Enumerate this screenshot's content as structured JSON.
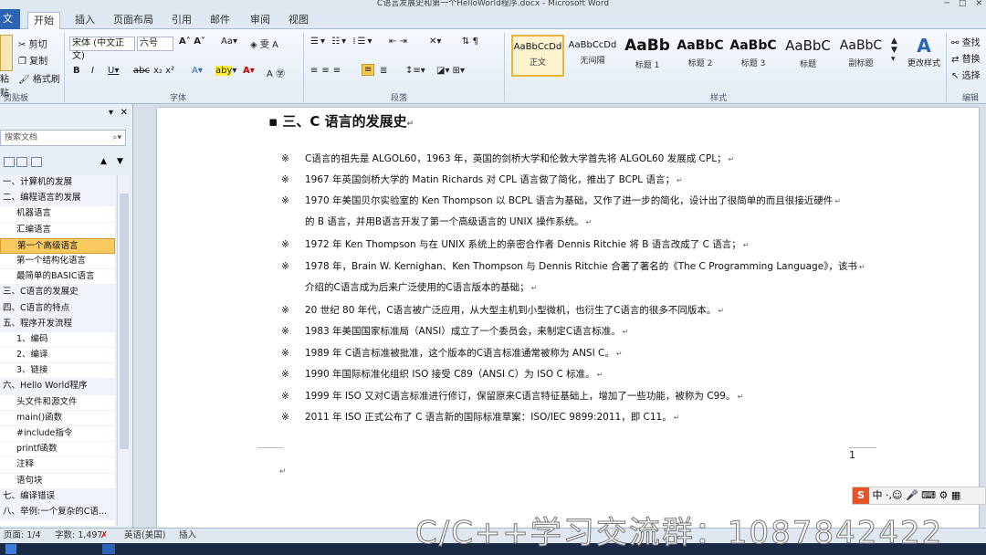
{
  "window": {
    "title": "C语言发展史和第一个HelloWorld程序.docx - Microsoft Word"
  },
  "tabs": [
    "文件",
    "开始",
    "插入",
    "页面布局",
    "引用",
    "邮件",
    "审阅",
    "视图"
  ],
  "ribbon": {
    "clipboard": {
      "paste": "粘贴",
      "cut": "剪切",
      "copy": "复制",
      "format_painter": "格式刷",
      "label": "剪贴板"
    },
    "font": {
      "font_name": "宋体 (中文正文)",
      "font_size": "六号",
      "label": "字体"
    },
    "paragraph": {
      "label": "段落"
    },
    "styles": {
      "label": "样式",
      "items": [
        {
          "sample": "AaBbCcDd",
          "name": "正文"
        },
        {
          "sample": "AaBbCcDd",
          "name": "无间隔"
        },
        {
          "sample": "AaBb",
          "name": "标题 1"
        },
        {
          "sample": "AaBbC",
          "name": "标题 2"
        },
        {
          "sample": "AaBbC",
          "name": "标题 3"
        },
        {
          "sample": "AaBbC",
          "name": "标题"
        },
        {
          "sample": "AaBbC",
          "name": "副标题"
        }
      ],
      "change_styles": "更改样式"
    },
    "editing": {
      "find": "查找",
      "replace": "替换",
      "select": "选择",
      "label": "编辑"
    }
  },
  "navpane": {
    "search_placeholder": "搜索文档",
    "items": [
      {
        "text": "一、计算机的发展",
        "level": 1,
        "selected": false
      },
      {
        "text": "二、编程语言的发展",
        "level": 1,
        "selected": false
      },
      {
        "text": "机器语言",
        "level": 2,
        "selected": false
      },
      {
        "text": "汇编语言",
        "level": 2,
        "selected": false
      },
      {
        "text": "第一个高级语言",
        "level": 2,
        "selected": true
      },
      {
        "text": "第一个结构化语言",
        "level": 2,
        "selected": false
      },
      {
        "text": "最简单的BASIC语言",
        "level": 2,
        "selected": false
      },
      {
        "text": "三、C语言的发展史",
        "level": 1,
        "selected": false
      },
      {
        "text": "四、C语言的特点",
        "level": 1,
        "selected": false
      },
      {
        "text": "五、程序开发流程",
        "level": 1,
        "selected": false
      },
      {
        "text": "1、编码",
        "level": 2,
        "selected": false
      },
      {
        "text": "2、编译",
        "level": 2,
        "selected": false
      },
      {
        "text": "3、链接",
        "level": 2,
        "selected": false
      },
      {
        "text": "六、Hello World程序",
        "level": 1,
        "selected": false
      },
      {
        "text": "头文件和源文件",
        "level": 2,
        "selected": false
      },
      {
        "text": "main()函数",
        "level": 2,
        "selected": false
      },
      {
        "text": "#include指令",
        "level": 2,
        "selected": false
      },
      {
        "text": "printf函数",
        "level": 2,
        "selected": false
      },
      {
        "text": "注释",
        "level": 2,
        "selected": false
      },
      {
        "text": "语句块",
        "level": 2,
        "selected": false
      },
      {
        "text": "七、编译错误",
        "level": 1,
        "selected": false
      },
      {
        "text": "八、举例:一个复杂的C语...",
        "level": 1,
        "selected": false
      }
    ]
  },
  "document": {
    "heading": "三、C 语言的发展史",
    "bullet_mark": "※",
    "lines": [
      {
        "bullet": true,
        "text": "C语言的祖先是 ALGOL60，1963 年，英国的剑桥大学和伦敦大学首先将 ALGOL60 发展成 CPL；"
      },
      {
        "bullet": true,
        "text": "1967 年英国剑桥大学的 Matin Richards 对 CPL 语言做了简化，推出了 BCPL 语言；"
      },
      {
        "bullet": true,
        "text": "1970 年美国贝尔实验室的 Ken Thompson 以 BCPL 语言为基础，又作了进一步的简化，设计出了很简单的而且很接近硬件"
      },
      {
        "bullet": false,
        "text": "的 B 语言，并用B语言开发了第一个高级语言的 UNIX 操作系统。"
      },
      {
        "bullet": true,
        "text": "1972 年 Ken Thompson 与在 UNIX 系统上的亲密合作者 Dennis Ritchie 将 B 语言改成了 C 语言；"
      },
      {
        "bullet": true,
        "text": "1978 年，Brain W. Kernighan、Ken Thompson 与 Dennis Ritchie 合著了著名的《The C Programming Language》，该书"
      },
      {
        "bullet": false,
        "text": "介绍的C语言成为后来广泛使用的C语言版本的基础；"
      },
      {
        "bullet": true,
        "text": "20 世纪 80 年代，C语言被广泛应用，从大型主机到小型微机，也衍生了C语言的很多不同版本。"
      },
      {
        "bullet": true,
        "text": "1983 年美国国家标准局（ANSI）成立了一个委员会，来制定C语言标准。"
      },
      {
        "bullet": true,
        "text": "1989 年 C语言标准被批准，这个版本的C语言标准通常被称为 ANSI C。"
      },
      {
        "bullet": true,
        "text": "1990 年国际标准化组织 ISO 接受 C89（ANSI C）为 ISO C 标准。"
      },
      {
        "bullet": true,
        "text": "1999 年 ISO 又对C语言标准进行修订，保留原来C语言特征基础上，增加了一些功能，被称为 C99。"
      },
      {
        "bullet": true,
        "text": "2011 年 ISO 正式公布了 C 语言新的国际标准草案：ISO/IEC 9899:2011，即 C11。"
      }
    ],
    "page_number": "1",
    "para_mark": "↵"
  },
  "statusbar": {
    "page": "页面: 1/4",
    "words": "字数: 1,497",
    "language": "英语(美国)",
    "mode": "插入"
  },
  "ime": {
    "logo": "S",
    "mode": "中"
  },
  "overlay_text": "C/C++学习交流群：1087842422",
  "colors": {
    "accent": "#2b64b5",
    "selected_nav": "#f8c95e",
    "selected_style": "#fdf3cf"
  }
}
